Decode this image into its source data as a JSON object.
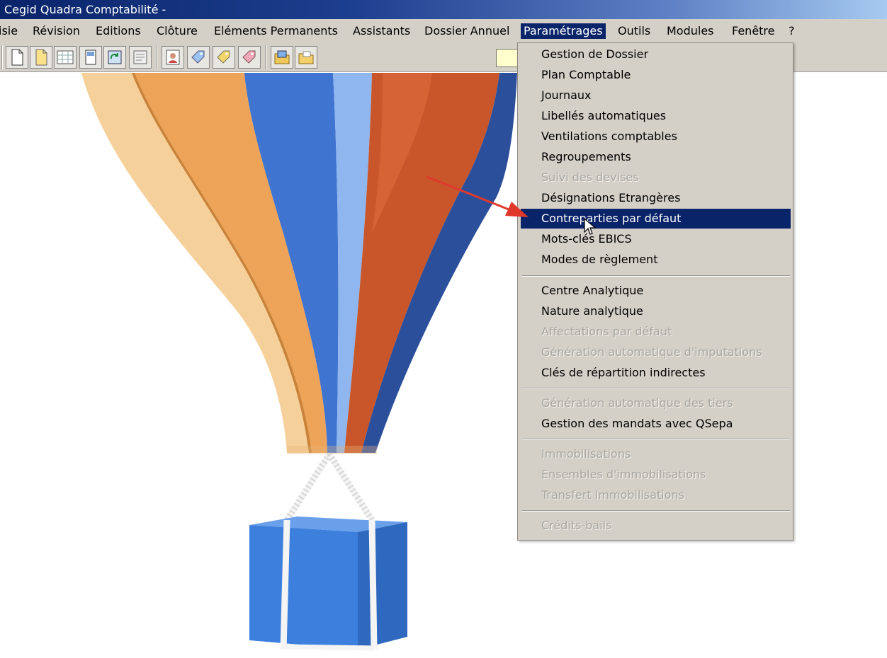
{
  "window": {
    "title": "Cegid Quadra Comptabilité -"
  },
  "menubar": {
    "items": [
      {
        "label": "isie",
        "active": false
      },
      {
        "label": "Révision",
        "active": false
      },
      {
        "label": "Editions",
        "active": false
      },
      {
        "label": "Clôture",
        "active": false
      },
      {
        "label": "Eléments Permanents",
        "active": false
      },
      {
        "label": "Assistants",
        "active": false
      },
      {
        "label": "Dossier Annuel",
        "active": false
      },
      {
        "label": "Paramétrages",
        "active": true
      },
      {
        "label": "Outils",
        "active": false
      },
      {
        "label": "Modules",
        "active": false
      },
      {
        "label": "Fenêtre",
        "active": false
      },
      {
        "label": "?",
        "active": false
      }
    ]
  },
  "toolbar": {
    "buttons": [
      {
        "icon": "blank-document-icon"
      },
      {
        "icon": "yellow-document-icon"
      },
      {
        "icon": "grid-sheet-icon"
      },
      {
        "icon": "ledger-icon"
      },
      {
        "icon": "refresh-sheet-icon"
      },
      {
        "icon": "form-sheet-icon"
      },
      {
        "icon": "user-card-icon"
      },
      {
        "icon": "blue-tag-icon"
      },
      {
        "icon": "yellow-tag-icon"
      },
      {
        "icon": "pink-tag-icon"
      },
      {
        "icon": "folder-sheet-icon"
      },
      {
        "icon": "folder-icon"
      }
    ]
  },
  "dropdown": {
    "items": [
      {
        "label": "Gestion de Dossier",
        "state": "enabled"
      },
      {
        "label": "Plan Comptable",
        "state": "enabled"
      },
      {
        "label": "Journaux",
        "state": "enabled"
      },
      {
        "label": "Libellés automatiques",
        "state": "enabled"
      },
      {
        "label": "Ventilations comptables",
        "state": "enabled"
      },
      {
        "label": "Regroupements",
        "state": "enabled"
      },
      {
        "label": "Suivi des devises",
        "state": "disabled"
      },
      {
        "label": "Désignations Etrangères",
        "state": "enabled"
      },
      {
        "label": "Contreparties par défaut",
        "state": "selected"
      },
      {
        "label": "Mots-clés EBICS",
        "state": "enabled"
      },
      {
        "label": "Modes de règlement",
        "state": "enabled"
      },
      {
        "label": "Centre Analytique",
        "state": "enabled"
      },
      {
        "label": "Nature analytique",
        "state": "enabled"
      },
      {
        "label": "Affectations par défaut",
        "state": "disabled"
      },
      {
        "label": "Génération automatique d'imputations",
        "state": "disabled"
      },
      {
        "label": "Clés de répartition indirectes",
        "state": "enabled"
      },
      {
        "label": "Génération automatique des tiers",
        "state": "disabled"
      },
      {
        "label": "Gestion des mandats avec QSepa",
        "state": "enabled"
      },
      {
        "label": "Immobilisations",
        "state": "disabled"
      },
      {
        "label": "Ensembles d'immobilisations",
        "state": "disabled"
      },
      {
        "label": "Transfert Immobilisations",
        "state": "disabled"
      },
      {
        "label": "Crédits-bails",
        "state": "disabled"
      }
    ]
  },
  "colors": {
    "menu_highlight": "#0a246a",
    "arrow": "#e0392b",
    "balloon_cream": "#f6d09a",
    "balloon_orange": "#eda458",
    "balloon_blue": "#3f74d0",
    "balloon_light_blue": "#8fb6ee",
    "balloon_rust": "#c8562a",
    "balloon_navy": "#2c4f9c",
    "basket_blue": "#3d7fdc"
  }
}
